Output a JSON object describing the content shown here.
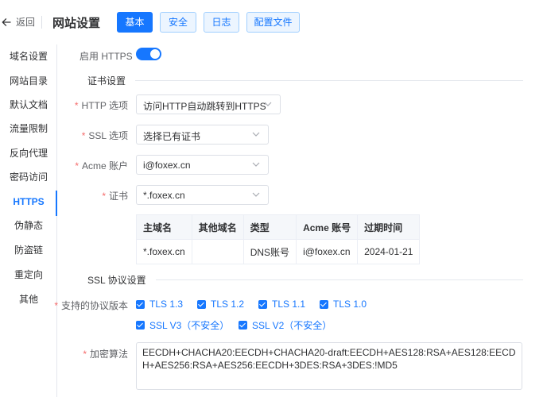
{
  "header": {
    "back_label": "返回",
    "title": "网站设置",
    "tabs": [
      {
        "label": "基本",
        "active": true
      },
      {
        "label": "安全",
        "active": false
      },
      {
        "label": "日志",
        "active": false
      },
      {
        "label": "配置文件",
        "active": false
      }
    ]
  },
  "sidebar": {
    "items": [
      {
        "label": "域名设置"
      },
      {
        "label": "网站目录"
      },
      {
        "label": "默认文档"
      },
      {
        "label": "流量限制"
      },
      {
        "label": "反向代理"
      },
      {
        "label": "密码访问"
      },
      {
        "label": "HTTPS",
        "active": true
      },
      {
        "label": "伪静态"
      },
      {
        "label": "防盗链"
      },
      {
        "label": "重定向"
      },
      {
        "label": "其他"
      }
    ]
  },
  "https": {
    "enable_label": "启用 HTTPS",
    "enabled": true,
    "cert_section": "证书设置",
    "http_option_label": "HTTP 选项",
    "http_option_value": "访问HTTP自动跳转到HTTPS",
    "ssl_option_label": "SSL 选项",
    "ssl_option_value": "选择已有证书",
    "acme_label": "Acme 账户",
    "acme_value": "i@foxex.cn",
    "cert_label": "证书",
    "cert_value": "*.foxex.cn",
    "table": {
      "headers": [
        "主域名",
        "其他域名",
        "类型",
        "Acme 账号",
        "过期时间"
      ],
      "rows": [
        [
          "*.foxex.cn",
          "",
          "DNS账号",
          "i@foxex.cn",
          "2024-01-21"
        ]
      ]
    },
    "ssl_section": "SSL 协议设置",
    "protocols_label": "支持的协议版本",
    "protocols": [
      {
        "label": "TLS 1.3",
        "checked": true
      },
      {
        "label": "TLS 1.2",
        "checked": true
      },
      {
        "label": "TLS 1.1",
        "checked": true
      },
      {
        "label": "TLS 1.0",
        "checked": true
      },
      {
        "label": "SSL V3（不安全）",
        "checked": true
      },
      {
        "label": "SSL V2（不安全）",
        "checked": true
      }
    ],
    "cipher_label": "加密算法",
    "cipher_value": "EECDH+CHACHA20:EECDH+CHACHA20-draft:EECDH+AES128:RSA+AES128:EECDH+AES256:RSA+AES256:EECDH+3DES:RSA+3DES:!MD5"
  },
  "colors": {
    "primary": "#1677ff",
    "required": "#f56c6c",
    "border": "#dcdfe6"
  }
}
